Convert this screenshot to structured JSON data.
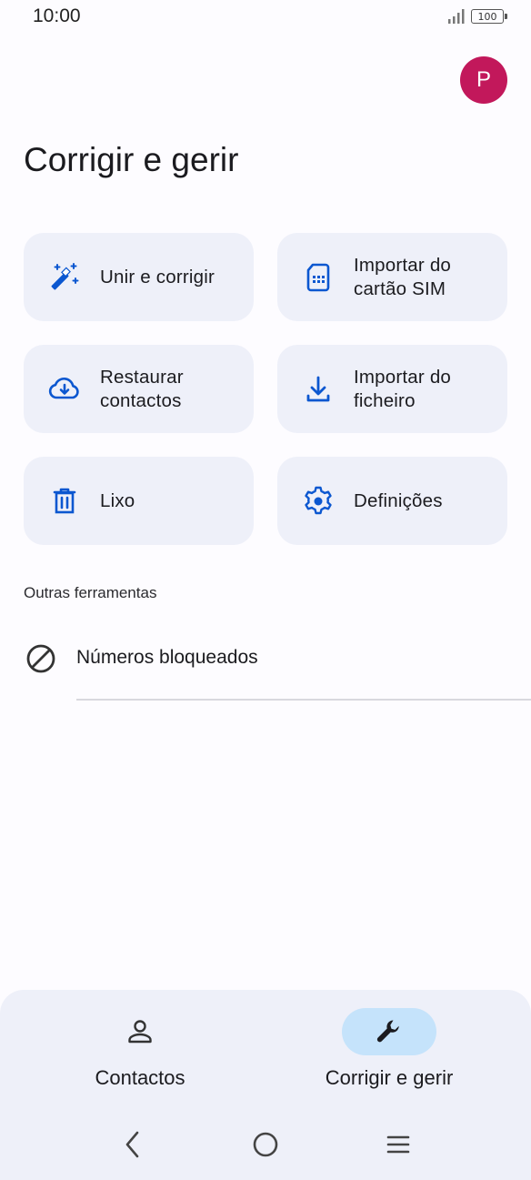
{
  "status_bar": {
    "time": "10:00",
    "battery": "100"
  },
  "header": {
    "avatar_letter": "P",
    "title": "Corrigir e gerir"
  },
  "tiles": [
    {
      "label": "Unir e corrigir",
      "icon": "magic-wand-icon"
    },
    {
      "label": "Importar do\ncartão SIM",
      "icon": "sim-card-icon"
    },
    {
      "label": "Restaurar\ncontactos",
      "icon": "cloud-download-icon"
    },
    {
      "label": "Importar do\nficheiro",
      "icon": "download-icon"
    },
    {
      "label": "Lixo",
      "icon": "trash-icon"
    },
    {
      "label": "Definições",
      "icon": "gear-icon"
    }
  ],
  "other_tools": {
    "header": "Outras ferramentas",
    "items": [
      {
        "label": "Números bloqueados",
        "icon": "block-icon"
      }
    ]
  },
  "bottom_nav": {
    "items": [
      {
        "label": "Contactos",
        "icon": "person-icon",
        "selected": false
      },
      {
        "label": "Corrigir e gerir",
        "icon": "wrench-icon",
        "selected": true
      }
    ]
  },
  "colors": {
    "accent": "#0b57d0",
    "tile_bg": "#eef0f9",
    "avatar_bg": "#c2185b",
    "selected_pill": "#c5e3fb"
  }
}
